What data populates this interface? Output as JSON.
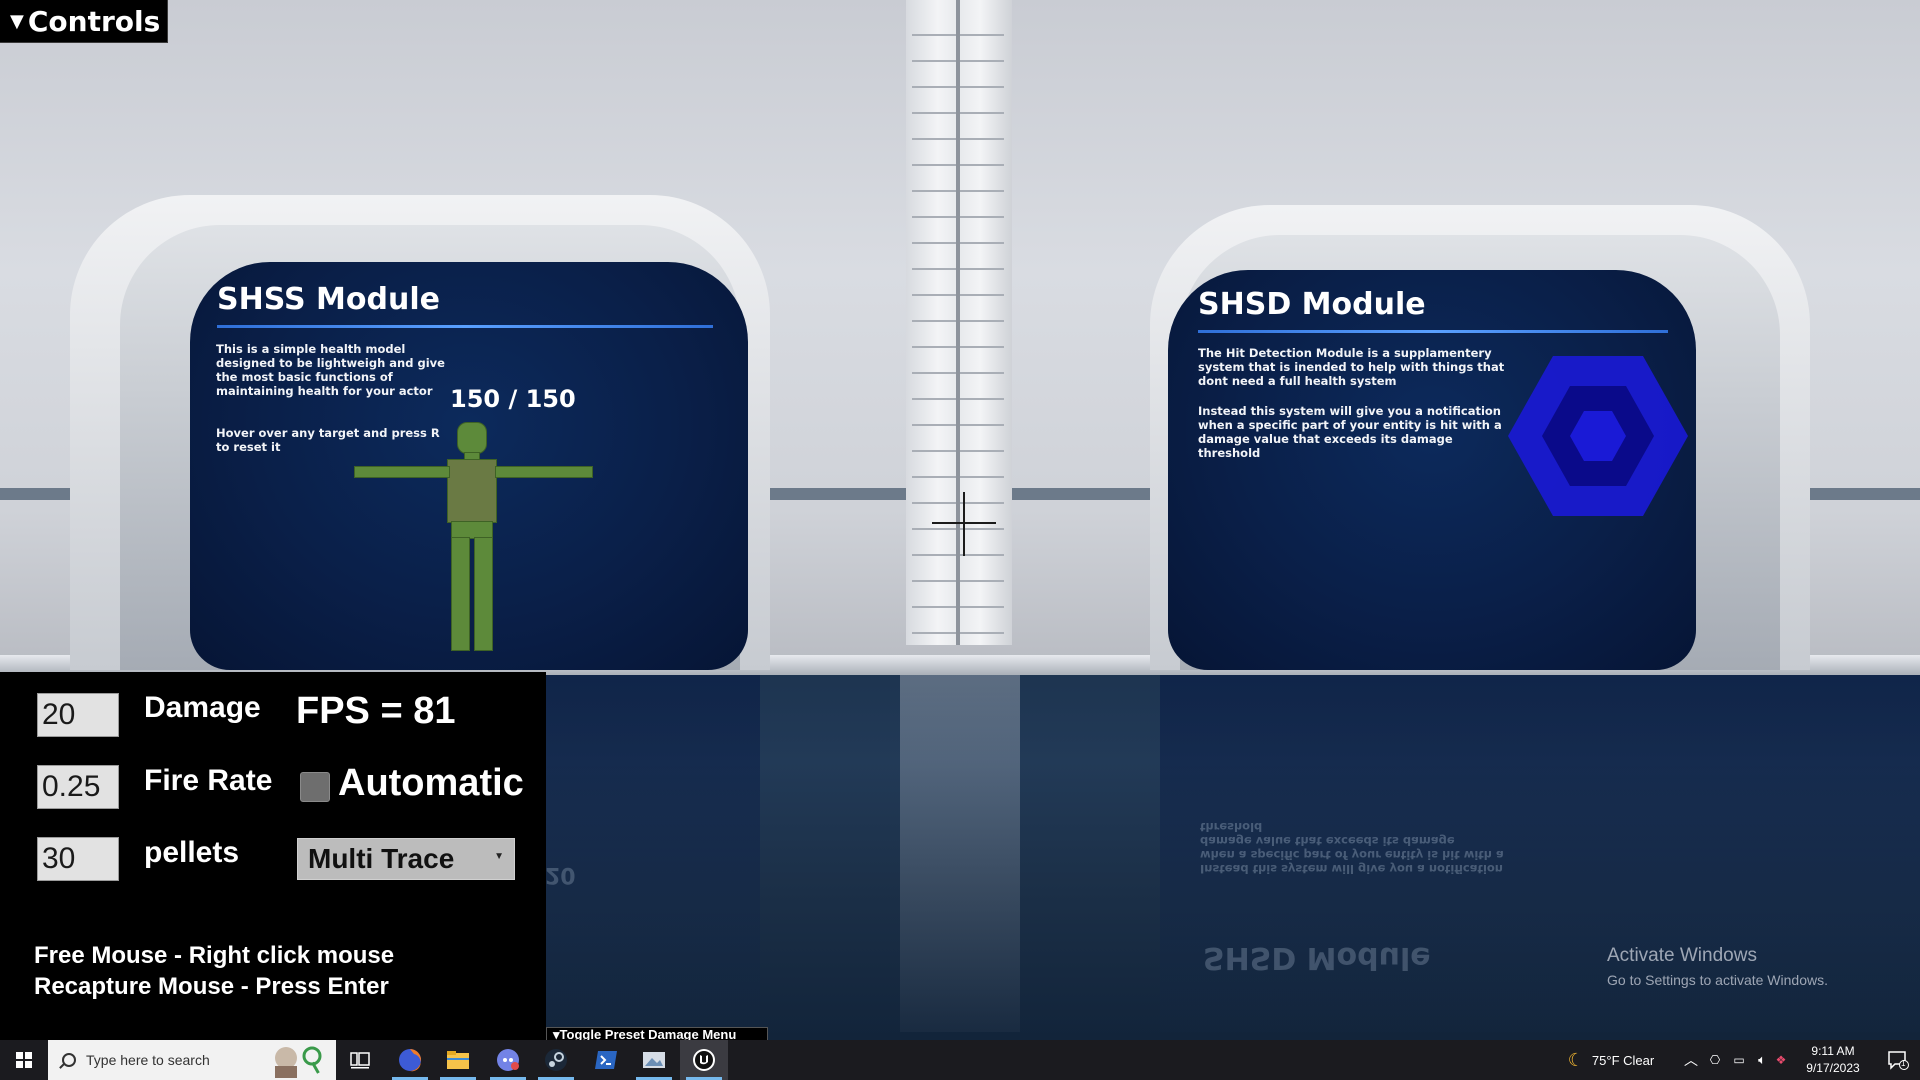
{
  "controls_tab": {
    "label": "Controls"
  },
  "shss": {
    "title": "SHSS Module",
    "description": "This is a simple health model designed to be lightweigh and give the most basic functions of maintaining health for your actor",
    "hint": "Hover over any target and press R to reset it",
    "health": "150 / 150"
  },
  "shsd": {
    "title": "SHSD Module",
    "description_1": "The Hit Detection Module is a supplamentery system that is inended to help with things that dont need a full health system",
    "description_2": "Instead this system will give you a notification when a specific part of your entity is hit with a damage value that exceeds its damage threshold",
    "emblem_color": "#1a1ad6"
  },
  "panel": {
    "damage_value": "20",
    "damage_label": "Damage",
    "fps_text": "FPS = 81",
    "fire_rate_value": "0.25",
    "fire_rate_label": "Fire Rate",
    "automatic_label": "Automatic",
    "automatic_checked": false,
    "pellets_value": "30",
    "pellets_label": "pellets",
    "trace_mode": "Multi Trace",
    "hint_free": "Free Mouse - Right click mouse",
    "hint_recapture": "Recapture Mouse - Press Enter"
  },
  "preset_toggle": {
    "label": "Toggle Preset Damage Menu"
  },
  "floor_reflection": {
    "number": "20"
  },
  "watermark": {
    "title": "Activate Windows",
    "subtitle": "Go to Settings to activate Windows."
  },
  "taskbar": {
    "search_placeholder": "Type here to search",
    "pinned": [
      "task-view-icon",
      "firefox-icon",
      "file-explorer-icon",
      "discord-icon",
      "steam-icon",
      "powershell-icon",
      "photos-icon",
      "unreal-engine-icon"
    ],
    "weather": "75°F  Clear",
    "time": "9:11 AM",
    "date": "9/17/2023",
    "notification_count": "1"
  }
}
